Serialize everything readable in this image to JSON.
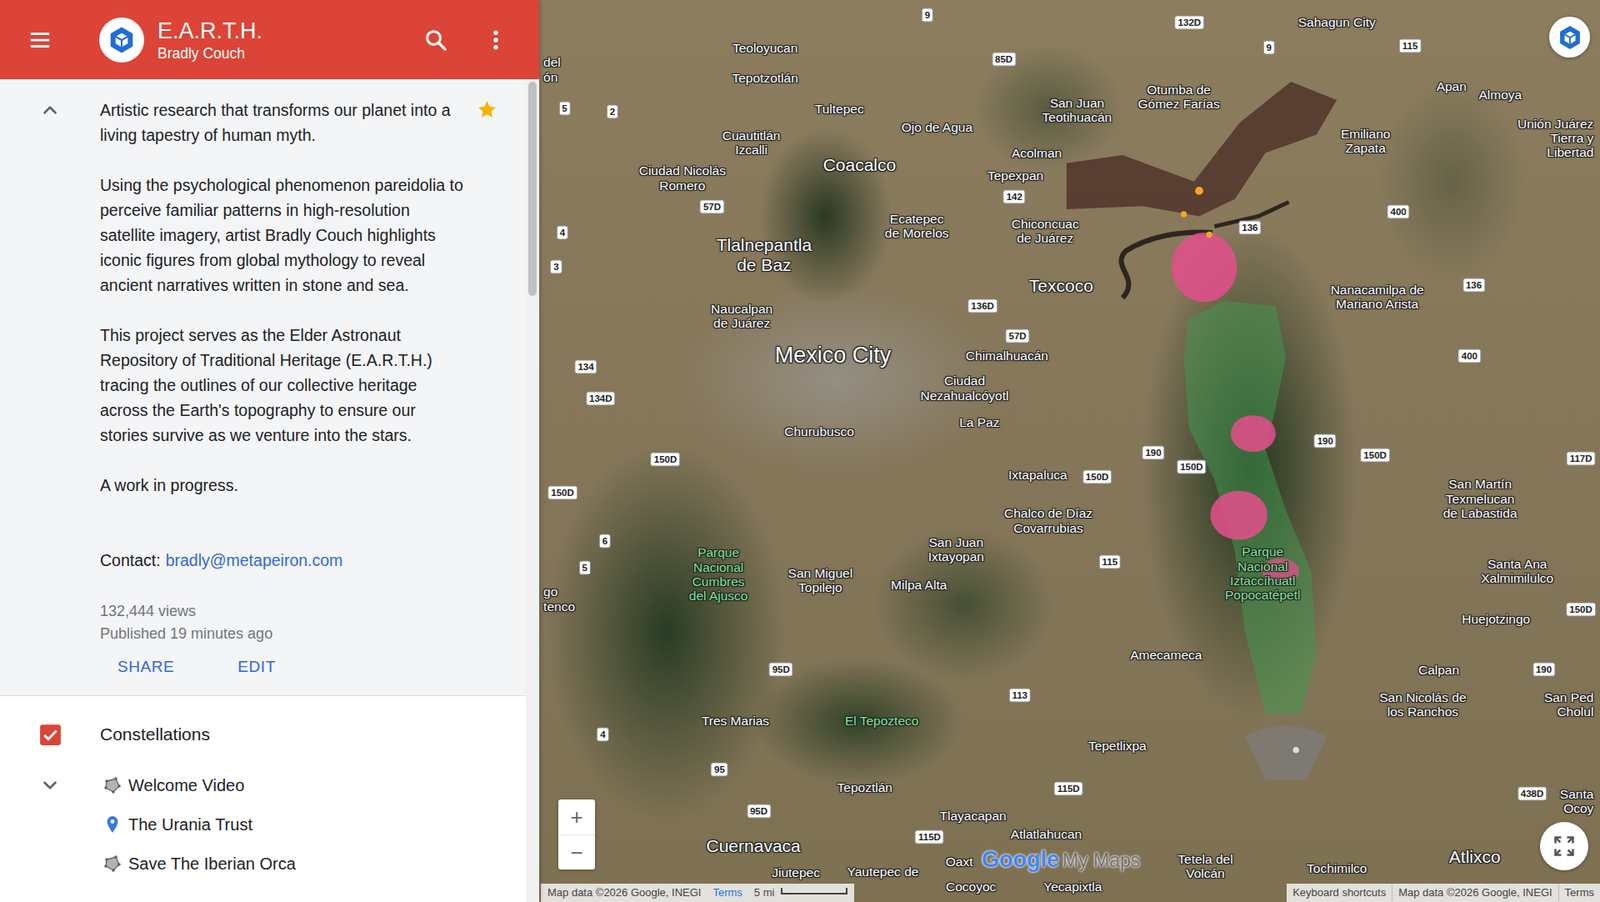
{
  "app": {
    "title": "E.A.R.T.H.",
    "subtitle": "Bradly Couch"
  },
  "about": {
    "expanded": true,
    "starred": true,
    "paragraphs": [
      "Artistic research that transforms our planet into a living tapestry of human myth.",
      "Using the psychological phenomenon pareidolia to perceive familiar patterns in high-resolution satellite imagery, artist Bradly Couch highlights iconic figures from global mythology to reveal ancient narratives written in stone and sea.",
      "This project serves as the Elder Astronaut Repository of Traditional Heritage (E.A.R.T.H.) tracing the outlines of our collective heritage across the Earth's topography to ensure our stories survive as we venture into the stars.",
      "A work in progress."
    ],
    "contact_label": "Contact:",
    "contact_email": "bradly@metapeiron.com",
    "views": "132,444 views",
    "published": "Published 19 minutes ago",
    "actions": [
      "SHARE",
      "EDIT"
    ]
  },
  "layers": [
    {
      "name": "Constellations",
      "checked": true,
      "expanded": true,
      "items": [
        {
          "label": "Welcome Video",
          "kind": "shape"
        },
        {
          "label": "The Urania Trust",
          "kind": "pin"
        },
        {
          "label": "Save The Iberian Orca",
          "kind": "shape"
        }
      ]
    }
  ],
  "map": {
    "places": [
      {
        "text": "del\nón",
        "kind": "edge"
      },
      {
        "text": "Teoloyucan",
        "kind": "town"
      },
      {
        "text": "Tepotzotlán",
        "kind": "town"
      },
      {
        "text": "Tultepec",
        "kind": "town"
      },
      {
        "text": "Ojo de Agua",
        "kind": "town"
      },
      {
        "text": "San Juan\nTeotihuacán",
        "kind": "town"
      },
      {
        "text": "Otumba de\nGómez Farías",
        "kind": "town"
      },
      {
        "text": "Sahagun City",
        "kind": "town"
      },
      {
        "text": "Apan",
        "kind": "town"
      },
      {
        "text": "Almoya",
        "kind": "town"
      },
      {
        "text": "Unión Juárez\nTierra y\nLibertad",
        "kind": "edge"
      },
      {
        "text": "Emiliano\nZapata",
        "kind": "town"
      },
      {
        "text": "Cuautitlán\nIzcalli",
        "kind": "town"
      },
      {
        "text": "Coacalco",
        "kind": "major"
      },
      {
        "text": "Ciudad Nicolás\nRomero",
        "kind": "town"
      },
      {
        "text": "Acolman",
        "kind": "town"
      },
      {
        "text": "Tepexpan",
        "kind": "town"
      },
      {
        "text": "Ecatepec\nde Morelos",
        "kind": "town"
      },
      {
        "text": "Chiconcuac\nde Juárez",
        "kind": "town"
      },
      {
        "text": "Tlalnepantla\nde Baz",
        "kind": "major"
      },
      {
        "text": "Texcoco",
        "kind": "major"
      },
      {
        "text": "Nanacamilpa de\nMariano Arista",
        "kind": "town"
      },
      {
        "text": "Naucalpan\nde Juárez",
        "kind": "town"
      },
      {
        "text": "Mexico City",
        "kind": "capital"
      },
      {
        "text": "Chimalhuacán",
        "kind": "town"
      },
      {
        "text": "Ciudad\nNezahualcóyotl",
        "kind": "town"
      },
      {
        "text": "La Paz",
        "kind": "town"
      },
      {
        "text": "Churubusco",
        "kind": "town"
      },
      {
        "text": "Ixtapaluca",
        "kind": "town"
      },
      {
        "text": "Chalco de Díaz\nCovarrubias",
        "kind": "town"
      },
      {
        "text": "San Martín\nTexmelucan\nde Labastida",
        "kind": "town"
      },
      {
        "text": "Santa Ana\nXalmimilulco",
        "kind": "town"
      },
      {
        "text": "Parque\nNacional\nCumbres\ndel Ajusco",
        "kind": "park"
      },
      {
        "text": "San Miguel\nTopilejo",
        "kind": "town"
      },
      {
        "text": "San Juan\nIxtayopan",
        "kind": "town"
      },
      {
        "text": "Milpa Alta",
        "kind": "town"
      },
      {
        "text": "Parque\nNacional\nIztaccíhuatl\nPopocatépetl",
        "kind": "park"
      },
      {
        "text": "Huejotzingo",
        "kind": "town"
      },
      {
        "text": "Amecameca",
        "kind": "town"
      },
      {
        "text": "Calpan",
        "kind": "town"
      },
      {
        "text": "San Nicolás de\nlos Ranchos",
        "kind": "town"
      },
      {
        "text": "San Ped\nCholul",
        "kind": "edge"
      },
      {
        "text": "Tres Marias",
        "kind": "town"
      },
      {
        "text": "El Tepozteco",
        "kind": "park"
      },
      {
        "text": "Tepetlixpa",
        "kind": "town"
      },
      {
        "text": "Tepoztlán",
        "kind": "town"
      },
      {
        "text": "Tlayacapan",
        "kind": "town"
      },
      {
        "text": "Atlatlahucan",
        "kind": "town"
      },
      {
        "text": "Cuernavaca",
        "kind": "major"
      },
      {
        "text": "Jiutepec",
        "kind": "town"
      },
      {
        "text": "Yautepec de",
        "kind": "town"
      },
      {
        "text": "Oaxt",
        "kind": "town"
      },
      {
        "text": "Cocoyoc",
        "kind": "town"
      },
      {
        "text": "Yecapixtla",
        "kind": "town"
      },
      {
        "text": "Tetela del\nVolcán",
        "kind": "town"
      },
      {
        "text": "Tochimilco",
        "kind": "town"
      },
      {
        "text": "Atlixco",
        "kind": "major"
      },
      {
        "text": "Santa\nOcoy",
        "kind": "edge"
      },
      {
        "text": "go\ntenco",
        "kind": "edge"
      }
    ],
    "roads": [
      "9",
      "132D",
      "85D",
      "9",
      "115",
      "5",
      "2",
      "57D",
      "4",
      "3",
      "142",
      "136",
      "400",
      "136D",
      "57D",
      "136",
      "134",
      "134D",
      "400",
      "150D",
      "150D",
      "190",
      "150D",
      "150D",
      "190",
      "150D",
      "117D",
      "6",
      "5",
      "115",
      "150D",
      "95D",
      "113",
      "190",
      "4",
      "95",
      "95D",
      "115D",
      "115D",
      "438D"
    ],
    "zoom": [
      "+",
      "−"
    ],
    "logo": {
      "google": "Google",
      "product": "My Maps"
    },
    "footer_left": {
      "attribution": "Map data ©2026 Google, INEGI",
      "terms": "Terms",
      "scale": "5 mi"
    },
    "footer_right": [
      "Keyboard shortcuts",
      "Map data ©2026 Google, INEGI",
      "Terms"
    ]
  }
}
